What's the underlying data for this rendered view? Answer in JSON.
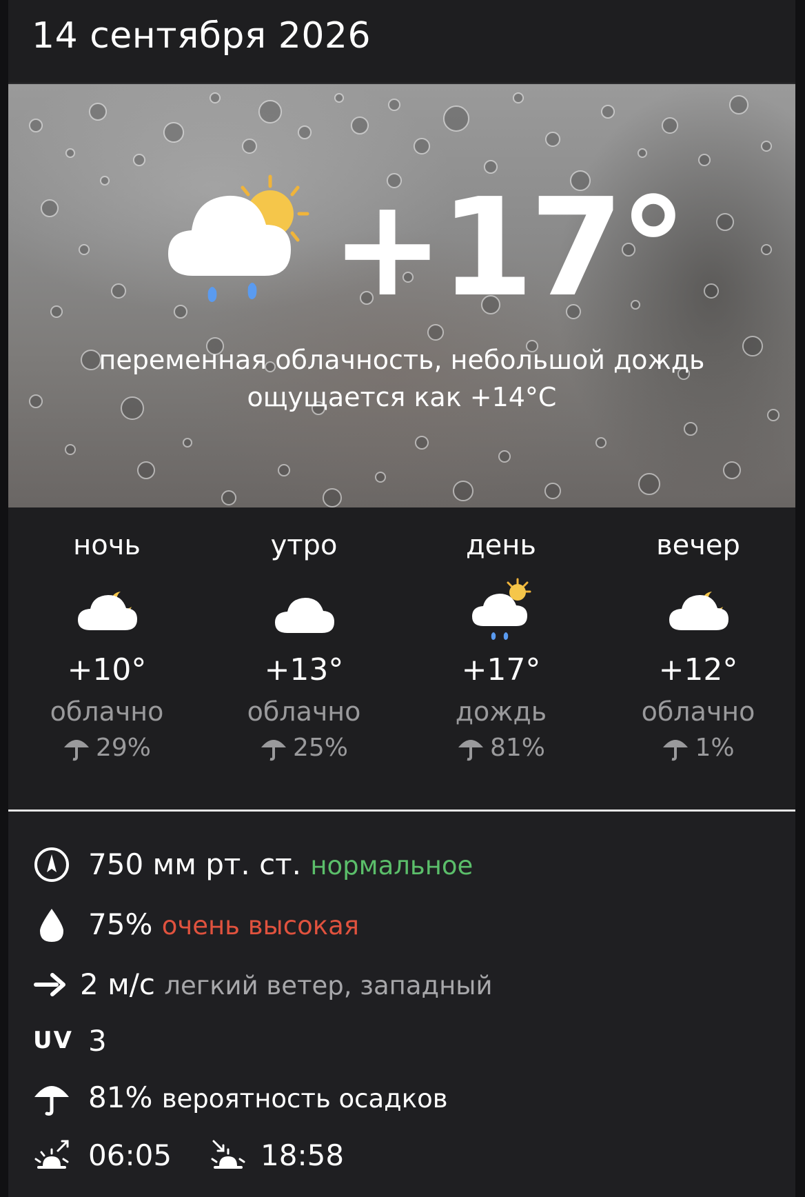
{
  "header": {
    "date": "14 сентября 2026"
  },
  "current": {
    "temperature": "+17°",
    "condition": "переменная облачность, небольшой дождь",
    "feels_like": "ощущается как +14°C",
    "icon": "partly-cloudy-rain-icon"
  },
  "periods": [
    {
      "label": "ночь",
      "temp": "+10°",
      "condition": "облачно",
      "precip": "29%",
      "icon": "cloud-moon-icon"
    },
    {
      "label": "утро",
      "temp": "+13°",
      "condition": "облачно",
      "precip": "25%",
      "icon": "cloud-icon"
    },
    {
      "label": "день",
      "temp": "+17°",
      "condition": "дождь",
      "precip": "81%",
      "icon": "cloud-sun-rain-icon"
    },
    {
      "label": "вечер",
      "temp": "+12°",
      "condition": "облачно",
      "precip": "1%",
      "icon": "cloud-moon-icon"
    }
  ],
  "details": {
    "pressure": {
      "value": "750 мм рт. ст.",
      "status": "нормальное",
      "icon": "compass-icon"
    },
    "humidity": {
      "value": "75%",
      "status": "очень высокая",
      "icon": "drop-icon"
    },
    "wind": {
      "value": "2 м/с",
      "description": "легкий ветер, западный",
      "icon": "arrow-right-icon"
    },
    "uv": {
      "label": "UV",
      "value": "3"
    },
    "precipitation": {
      "value": "81%",
      "description": "вероятность осадков",
      "icon": "umbrella-icon"
    },
    "sunrise": {
      "time": "06:05",
      "icon": "sunrise-icon"
    },
    "sunset": {
      "time": "18:58",
      "icon": "sunset-icon"
    }
  },
  "colors": {
    "background": "#1e1e20",
    "status_normal": "#5bbe6a",
    "status_high": "#e0523e",
    "muted_text": "#9a9a9c"
  }
}
